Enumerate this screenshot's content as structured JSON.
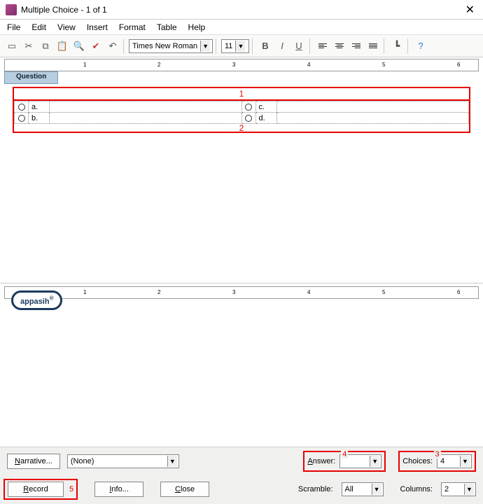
{
  "title": "Multiple Choice - 1 of 1",
  "menu": [
    "File",
    "Edit",
    "View",
    "Insert",
    "Format",
    "Table",
    "Help"
  ],
  "toolbar": {
    "font": "Times New Roman",
    "size": "11"
  },
  "tab": "Question",
  "annotations": {
    "n1": "1",
    "n2": "2",
    "n3": "3",
    "n4": "4",
    "n5": "5"
  },
  "choices_letters": {
    "a": "a.",
    "b": "b.",
    "c": "c.",
    "d": "d."
  },
  "ruler_labels": [
    "1",
    "2",
    "3",
    "4",
    "5",
    "6"
  ],
  "logo": "appasih",
  "bottom": {
    "narrative_btn": "Narrative...",
    "narrative_sel": "(None)",
    "answer_lbl": "Answer:",
    "answer_val": "",
    "choices_lbl": "Choices:",
    "choices_val": "4",
    "record_btn": "Record",
    "info_btn": "Info...",
    "close_btn": "Close",
    "scramble_lbl": "Scramble:",
    "scramble_val": "All",
    "columns_lbl": "Columns:",
    "columns_val": "2"
  }
}
